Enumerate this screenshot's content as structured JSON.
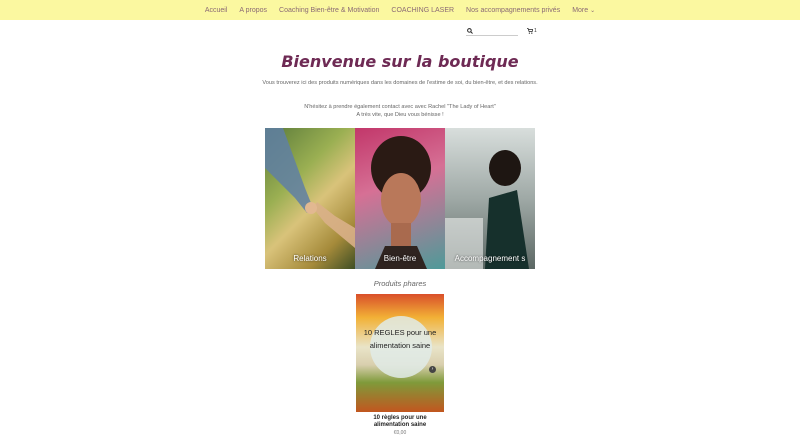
{
  "nav": {
    "items": [
      {
        "label": "Accueil"
      },
      {
        "label": "A propos"
      },
      {
        "label": "Coaching Bien-être & Motivation"
      },
      {
        "label": "COACHING LASER"
      },
      {
        "label": "Nos accompagnements privés"
      }
    ],
    "more_label": "More"
  },
  "search": {
    "placeholder": ""
  },
  "cart": {
    "count": "1"
  },
  "page": {
    "title": "Bienvenue sur la boutique",
    "intro": "Vous trouverez ici des produits numériques dans les domaines de l'estime de soi, du bien-être, et des relations.",
    "contact_line1": "N'hésitez à prendre également contact avec avec Rachel \"The Lady of Heart\"",
    "contact_line2": "A très vite, que Dieu vous bénisse !"
  },
  "categories": [
    {
      "label": "Relations"
    },
    {
      "label": "Bien-être"
    },
    {
      "label": "Accompagnement s"
    }
  ],
  "featured": {
    "title": "Produits phares",
    "products": [
      {
        "image_text": "10 REGLES pour une alimentation saine",
        "name": "10 règles pour une alimentation saine",
        "price": "€0,00"
      }
    ]
  },
  "colors": {
    "nav_bg": "#fbf8a0",
    "title": "#6e2a54"
  }
}
